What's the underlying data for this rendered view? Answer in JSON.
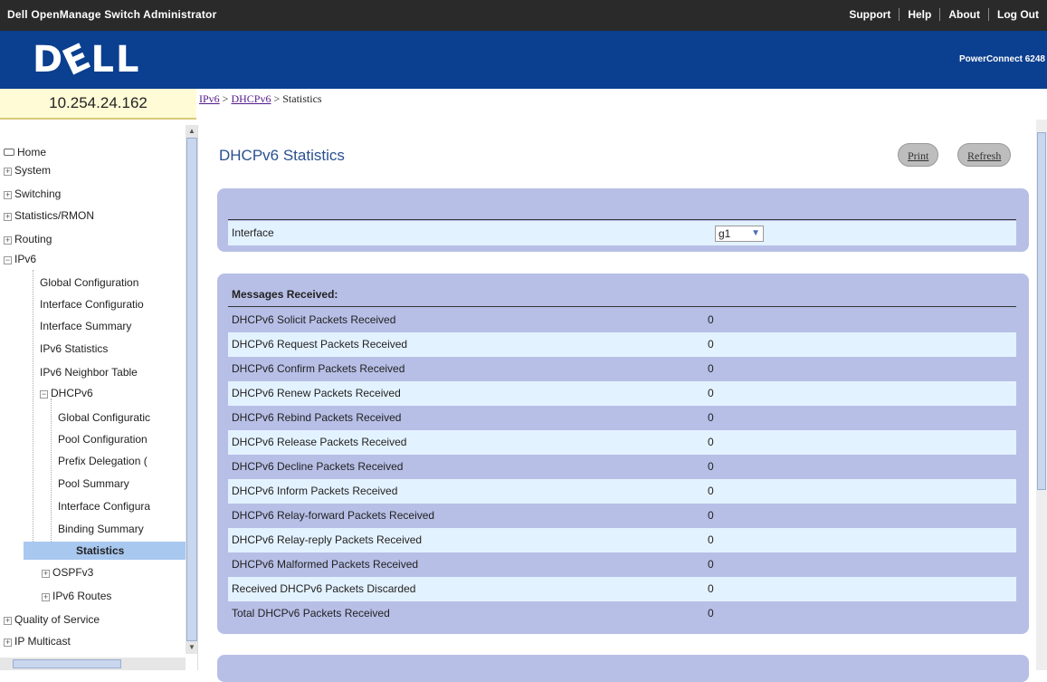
{
  "header": {
    "app_title": "Dell OpenManage Switch Administrator",
    "links": [
      "Support",
      "Help",
      "About",
      "Log Out"
    ],
    "logo": "DELL",
    "product": "PowerConnect 6248"
  },
  "ip_address": "10.254.24.162",
  "breadcrumb": {
    "item1": "IPv6",
    "sep1": " > ",
    "item2": "DHCPv6",
    "sep2": " > ",
    "current": "Statistics"
  },
  "tree": {
    "home": "Home",
    "system": "System",
    "switching": "Switching",
    "stats_rmon": "Statistics/RMON",
    "routing": "Routing",
    "ipv6": "IPv6",
    "global_config": "Global Configuration",
    "interface_config": "Interface Configuratio",
    "interface_summary": "Interface Summary",
    "ipv6_statistics": "IPv6 Statistics",
    "ipv6_neighbor": "IPv6 Neighbor Table",
    "dhcpv6": "DHCPv6",
    "dhcp_global_config": "Global Configuratic",
    "pool_config": "Pool Configuration",
    "prefix_delegation": "Prefix Delegation (",
    "pool_summary": "Pool Summary",
    "dhcp_interface_config": "Interface Configura",
    "binding_summary": "Binding Summary",
    "statistics": "Statistics",
    "ospfv3": "OSPFv3",
    "ipv6_routes": "IPv6 Routes",
    "qos": "Quality of Service",
    "ip_multicast": "IP Multicast"
  },
  "main": {
    "title": "DHCPv6 Statistics",
    "print_label": "Print",
    "refresh_label": "Refresh",
    "interface_label": "Interface",
    "interface_value": "g1",
    "messages_header": "Messages Received:",
    "rows": [
      {
        "label": "DHCPv6 Solicit Packets Received",
        "value": "0"
      },
      {
        "label": "DHCPv6 Request Packets Received",
        "value": "0"
      },
      {
        "label": "DHCPv6 Confirm Packets Received",
        "value": "0"
      },
      {
        "label": "DHCPv6 Renew Packets Received",
        "value": "0"
      },
      {
        "label": "DHCPv6 Rebind Packets Received",
        "value": "0"
      },
      {
        "label": "DHCPv6 Release Packets Received",
        "value": "0"
      },
      {
        "label": "DHCPv6 Decline Packets Received",
        "value": "0"
      },
      {
        "label": "DHCPv6 Inform Packets Received",
        "value": "0"
      },
      {
        "label": "DHCPv6 Relay-forward Packets Received",
        "value": "0"
      },
      {
        "label": "DHCPv6 Relay-reply Packets Received",
        "value": "0"
      },
      {
        "label": "DHCPv6 Malformed Packets Received",
        "value": "0"
      },
      {
        "label": "Received DHCPv6 Packets Discarded",
        "value": "0"
      },
      {
        "label": "Total DHCPv6 Packets Received",
        "value": "0"
      }
    ]
  },
  "colors": {
    "banner": "#0b3f8f",
    "panel": "#b7bfe6",
    "row_light": "#e3f2ff",
    "selected": "#a9c8f0"
  }
}
